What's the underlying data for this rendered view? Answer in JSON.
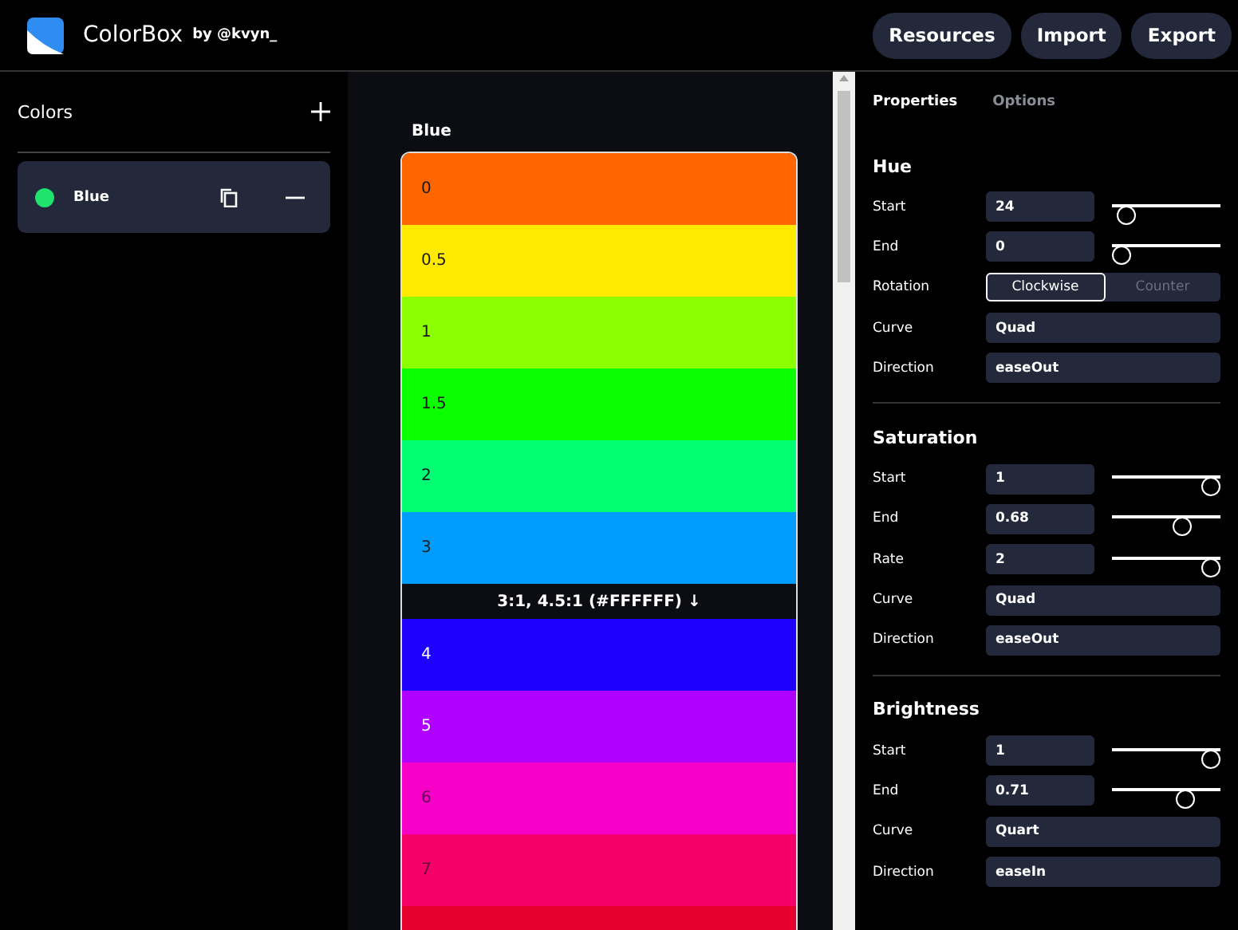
{
  "header": {
    "app_name": "ColorBox",
    "byline": "by @kvyn_",
    "buttons": [
      "Resources",
      "Import",
      "Export"
    ]
  },
  "sidebar": {
    "title": "Colors",
    "items": [
      {
        "name": "Blue",
        "color": "#1fe36d",
        "selected": true
      }
    ]
  },
  "palette": {
    "title": "Blue",
    "swatches": [
      {
        "kind": "swatch",
        "label": "0",
        "color": "#ff6600"
      },
      {
        "kind": "swatch",
        "label": "0.5",
        "color": "#ffea00"
      },
      {
        "kind": "swatch",
        "label": "1",
        "color": "#8cff00"
      },
      {
        "kind": "swatch",
        "label": "1.5",
        "color": "#0aff00"
      },
      {
        "kind": "swatch",
        "label": "2",
        "color": "#00ff73"
      },
      {
        "kind": "swatch",
        "label": "3",
        "color": "#009dff"
      },
      {
        "kind": "contrast",
        "label": "3:1, 4.5:1 (#FFFFFF) ↓"
      },
      {
        "kind": "swatch",
        "label": "4",
        "color": "#1e00ff"
      },
      {
        "kind": "swatch",
        "label": "5",
        "color": "#b000ff"
      },
      {
        "kind": "swatch",
        "label": "6",
        "color": "#f700c8"
      },
      {
        "kind": "swatch",
        "label": "7",
        "color": "#f5006a"
      },
      {
        "kind": "swatch",
        "color": "#e5002e"
      }
    ]
  },
  "panel": {
    "tabs": [
      {
        "label": "Properties",
        "selected": true
      },
      {
        "label": "Options",
        "selected": false
      }
    ],
    "sections": [
      {
        "title": "Hue",
        "rows": [
          {
            "kind": "number",
            "label": "Start",
            "value": "24",
            "level": 0.05
          },
          {
            "kind": "number",
            "label": "End",
            "value": "0",
            "level": 0
          },
          {
            "kind": "toggle",
            "label": "Rotation",
            "options": [
              {
                "label": "Clockwise",
                "selected": true
              },
              {
                "label": "Counter",
                "selected": false
              }
            ]
          },
          {
            "kind": "text",
            "label": "Curve",
            "value": "Quad"
          },
          {
            "kind": "text",
            "label": "Direction",
            "value": "easeOut"
          }
        ]
      },
      {
        "title": "Saturation",
        "rows": [
          {
            "kind": "number",
            "label": "Start",
            "value": "1",
            "level": 1
          },
          {
            "kind": "number",
            "label": "End",
            "value": "0.68",
            "level": 0.68
          },
          {
            "kind": "number",
            "label": "Rate",
            "value": "2",
            "level": 1
          },
          {
            "kind": "text",
            "label": "Curve",
            "value": "Quad"
          },
          {
            "kind": "text",
            "label": "Direction",
            "value": "easeOut"
          }
        ]
      },
      {
        "title": "Brightness",
        "rows": [
          {
            "kind": "number",
            "label": "Start",
            "value": "1",
            "level": 1
          },
          {
            "kind": "number",
            "label": "End",
            "value": "0.71",
            "level": 0.71
          },
          {
            "kind": "text",
            "label": "Curve",
            "value": "Quart"
          },
          {
            "kind": "text",
            "label": "Direction",
            "value": "easeIn"
          }
        ]
      }
    ]
  }
}
